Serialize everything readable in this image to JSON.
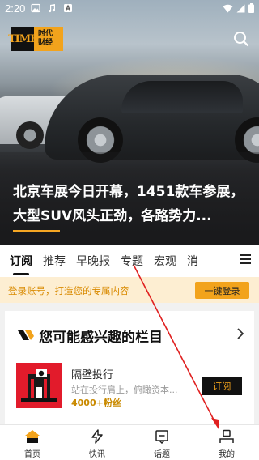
{
  "status_bar": {
    "time": "2:20",
    "icons": [
      "image-icon",
      "music-note-icon",
      "a-badge-icon"
    ],
    "right_icons": [
      "wifi-icon",
      "signal-icon",
      "battery-icon"
    ]
  },
  "header": {
    "logo_left": "TIME",
    "logo_right": "时代\n财经",
    "search_icon": "search-icon"
  },
  "hero": {
    "headline": "北京车展今日开幕，1451款车参展，大型SUV风头正劲，各路势力...",
    "accent_color": "#f5a623"
  },
  "tabs": [
    {
      "label": "订阅",
      "active": true
    },
    {
      "label": "推荐",
      "active": false
    },
    {
      "label": "早晚报",
      "active": false
    },
    {
      "label": "专题",
      "active": false
    },
    {
      "label": "宏观",
      "active": false
    },
    {
      "label": "消",
      "active": false
    }
  ],
  "login_banner": {
    "text": "登录账号，打造您的专属内容",
    "button": "一键登录"
  },
  "recommend": {
    "title": "您可能感兴趣的栏目",
    "column": {
      "name": "隔壁投行",
      "desc": "站在投行肩上，俯瞰资本...",
      "fans": "4000+粉丝",
      "subscribe": "订阅"
    }
  },
  "bottom_nav": [
    {
      "label": "首页",
      "icon": "home-icon"
    },
    {
      "label": "快讯",
      "icon": "lightning-icon"
    },
    {
      "label": "话题",
      "icon": "topic-icon"
    },
    {
      "label": "我的",
      "icon": "user-icon"
    }
  ],
  "colors": {
    "brand": "#f2a31c",
    "annotation": "#e02020"
  }
}
